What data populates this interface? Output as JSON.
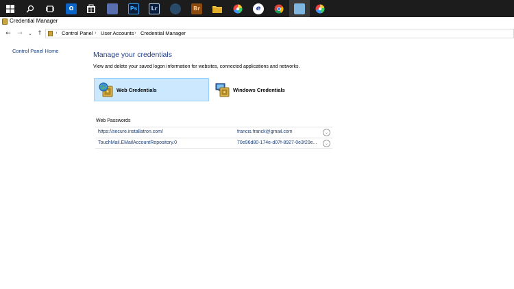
{
  "taskbar": {
    "icons": [
      {
        "name": "windows-start-icon"
      },
      {
        "name": "search-icon"
      },
      {
        "name": "task-view-icon"
      },
      {
        "name": "outlook-icon",
        "label": "O"
      },
      {
        "name": "store-icon"
      },
      {
        "name": "app-icon"
      },
      {
        "name": "photoshop-icon",
        "label": "Ps"
      },
      {
        "name": "lightroom-icon",
        "label": "Lr"
      },
      {
        "name": "app-icon"
      },
      {
        "name": "bridge-icon",
        "label": "Br"
      },
      {
        "name": "file-explorer-icon"
      },
      {
        "name": "app-icon"
      },
      {
        "name": "app-icon"
      },
      {
        "name": "chrome-icon"
      },
      {
        "name": "control-panel-icon"
      },
      {
        "name": "app-icon"
      }
    ]
  },
  "window": {
    "title": "Credential Manager"
  },
  "breadcrumb": {
    "items": [
      "Control Panel",
      "User Accounts",
      "Credential Manager"
    ]
  },
  "leftnav": {
    "home_link": "Control Panel Home"
  },
  "main": {
    "heading": "Manage your credentials",
    "description": "View and delete your saved logon information for websites, connected applications and networks.",
    "tiles": [
      {
        "label": "Web Credentials",
        "selected": true
      },
      {
        "label": "Windows Credentials",
        "selected": false
      }
    ],
    "section_title": "Web Passwords",
    "rows": [
      {
        "url": "https://secure.installatron.com/",
        "user": "francis.franck@gmail.com"
      },
      {
        "url": "TouchMail.EMailAccountRepository.0",
        "user": "70e96d80-174e-d07f-8927-0e3f20e..."
      }
    ]
  },
  "colors": {
    "taskbar_bg": "#1c1c1c",
    "heading": "#1e3e8c",
    "link": "#1a3e78",
    "selected_tile": "#cce8ff"
  }
}
